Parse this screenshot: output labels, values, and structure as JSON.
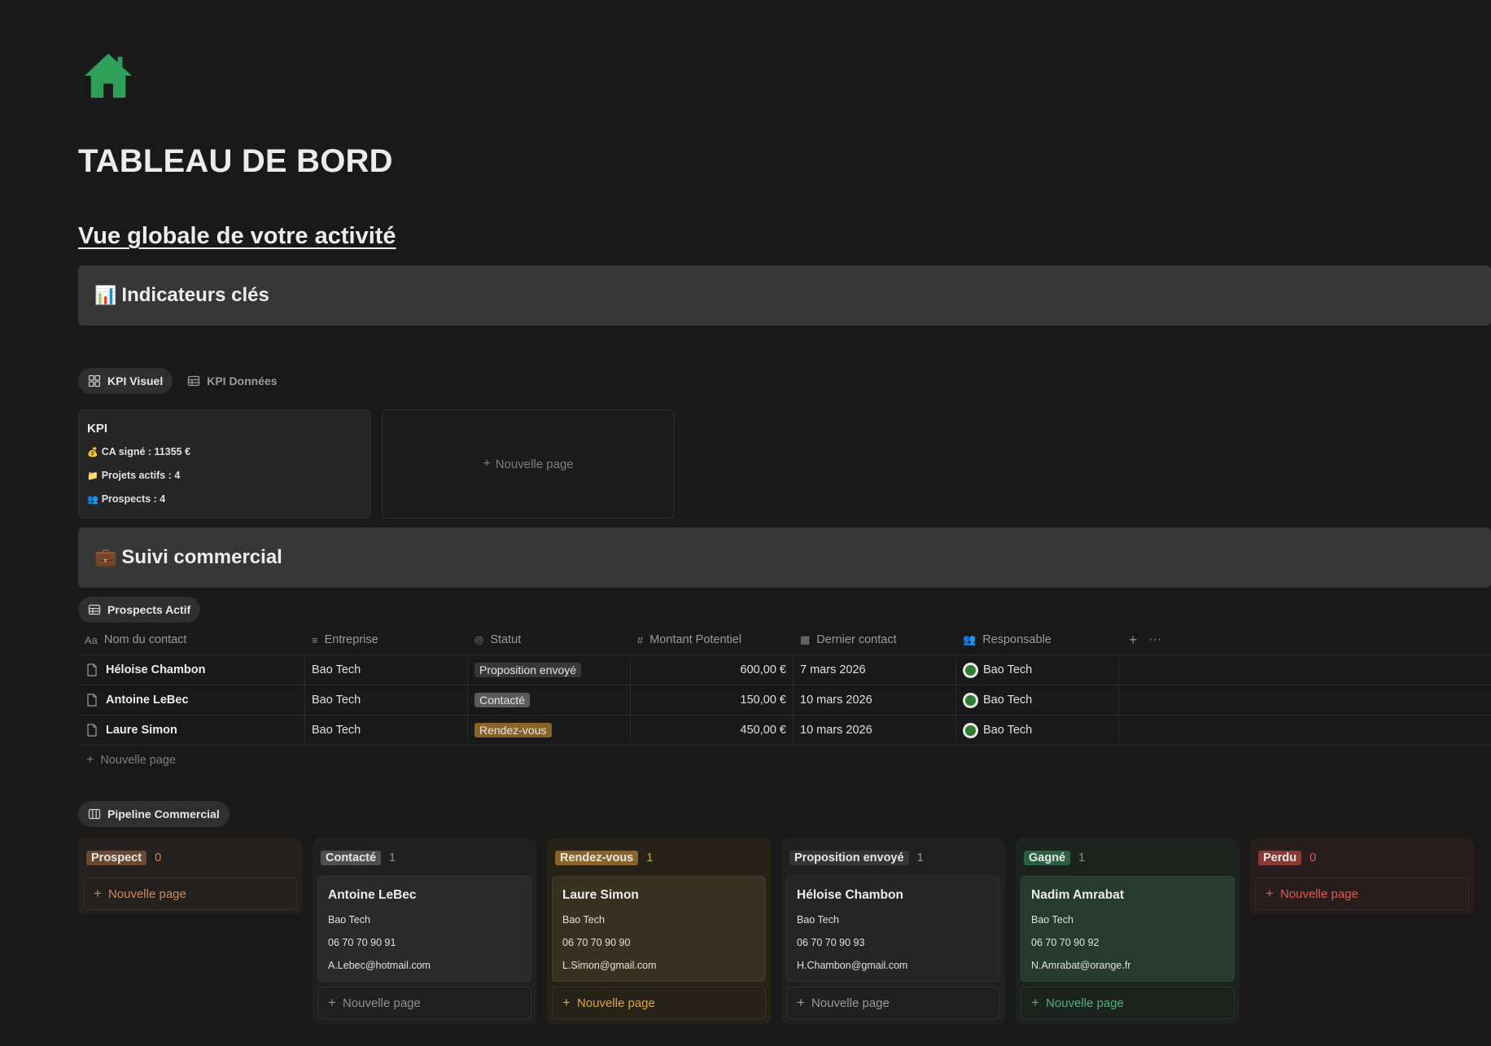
{
  "page": {
    "title": "TABLEAU DE BORD",
    "subtitle": "Vue globale de votre activité"
  },
  "colors": {
    "background": "#191919",
    "icon_green": "#2f9e58",
    "callout_bg": "#373737"
  },
  "callouts": {
    "kpi": {
      "emoji": "📊",
      "label": "Indicateurs clés"
    },
    "sales": {
      "emoji": "💼",
      "label": "Suivi commercial"
    }
  },
  "kpi_views": {
    "tabs": [
      {
        "label": "KPI Visuel",
        "icon": "gallery-icon",
        "active": true
      },
      {
        "label": "KPI Données",
        "icon": "table-icon",
        "active": false
      }
    ],
    "card": {
      "title": "KPI",
      "lines": [
        {
          "emoji": "💰",
          "text": "CA signé : 11355 €"
        },
        {
          "emoji": "📁",
          "text": "Projets actifs : 4"
        },
        {
          "emoji": "👥",
          "text": "Prospects : 4"
        }
      ]
    },
    "new_page_label": "Nouvelle page"
  },
  "prospects": {
    "view_label": "Prospects Actif",
    "columns": [
      {
        "label": "Nom du contact",
        "icon": "title-icon",
        "icon_glyph": "Aa"
      },
      {
        "label": "Entreprise",
        "icon": "text-lines-icon",
        "icon_glyph": "≡"
      },
      {
        "label": "Statut",
        "icon": "status-icon",
        "icon_glyph": "◎"
      },
      {
        "label": "Montant Potentiel",
        "icon": "number-icon",
        "icon_glyph": "#"
      },
      {
        "label": "Dernier contact",
        "icon": "calendar-icon",
        "icon_glyph": "▦"
      },
      {
        "label": "Responsable",
        "icon": "people-icon",
        "icon_glyph": "👥"
      }
    ],
    "rows": [
      {
        "name": "Héloise Chambon",
        "company": "Bao Tech",
        "status": "Proposition envoyé",
        "status_color": "#373737",
        "amount": "600,00 €",
        "last_contact": "7 mars 2026",
        "owner": "Bao Tech"
      },
      {
        "name": "Antoine LeBec",
        "company": "Bao Tech",
        "status": "Contacté",
        "status_color": "#5a5a5a",
        "amount": "150,00 €",
        "last_contact": "10 mars 2026",
        "owner": "Bao Tech"
      },
      {
        "name": "Laure Simon",
        "company": "Bao Tech",
        "status": "Rendez-vous",
        "status_color": "#89632a",
        "amount": "450,00 €",
        "last_contact": "10 mars 2026",
        "owner": "Bao Tech"
      }
    ],
    "new_page_label": "Nouvelle page"
  },
  "pipeline": {
    "view_label": "Pipeline Commercial",
    "columns": [
      {
        "label": "Prospect",
        "count": "0",
        "tag_color": "#6b4a33",
        "col_bg": "#23201d",
        "accent": "#c98a5a",
        "card_bg": "#2a2623",
        "cards": [],
        "new_label": "Nouvelle page"
      },
      {
        "label": "Contacté",
        "count": "1",
        "tag_color": "#4f4f4f",
        "col_bg": "#202020",
        "accent": "#8f8f8f",
        "card_bg": "#2a2a2a",
        "cards": [
          {
            "name": "Antoine LeBec",
            "company": "Bao Tech",
            "phone": "06 70 70 90 91",
            "email": "A.Lebec@hotmail.com"
          }
        ],
        "new_label": "Nouvelle page"
      },
      {
        "label": "Rendez-vous",
        "count": "1",
        "tag_color": "#89632a",
        "col_bg": "#262218",
        "accent": "#e0a63a",
        "card_bg": "#3a3220",
        "cards": [
          {
            "name": "Laure Simon",
            "company": "Bao Tech",
            "phone": "06 70 70 90 90",
            "email": "L.Simon@gmail.com"
          }
        ],
        "new_label": "Nouvelle page"
      },
      {
        "label": "Proposition envoyé",
        "count": "1",
        "tag_color": "#353535",
        "col_bg": "#202020",
        "accent": "#9b9b9b",
        "card_bg": "#252525",
        "cards": [
          {
            "name": "Héloise Chambon",
            "company": "Bao Tech",
            "phone": "06 70 70 90 93",
            "email": "H.Chambon@gmail.com"
          }
        ],
        "new_label": "Nouvelle page"
      },
      {
        "label": "Gagné",
        "count": "1",
        "tag_color": "#2b5f41",
        "col_bg": "#1c231f",
        "accent": "#4fb27a",
        "card_bg": "#263a2d",
        "cards": [
          {
            "name": "Nadim Amrabat",
            "company": "Bao Tech",
            "phone": "06 70 70 90 92",
            "email": "N.Amrabat@orange.fr"
          }
        ],
        "new_label": "Nouvelle page"
      },
      {
        "label": "Perdu",
        "count": "0",
        "tag_color": "#8a3a35",
        "col_bg": "#271d1c",
        "accent": "#e05a4f",
        "card_bg": "#2e2220",
        "cards": [],
        "new_label": "Nouvelle page"
      }
    ]
  }
}
